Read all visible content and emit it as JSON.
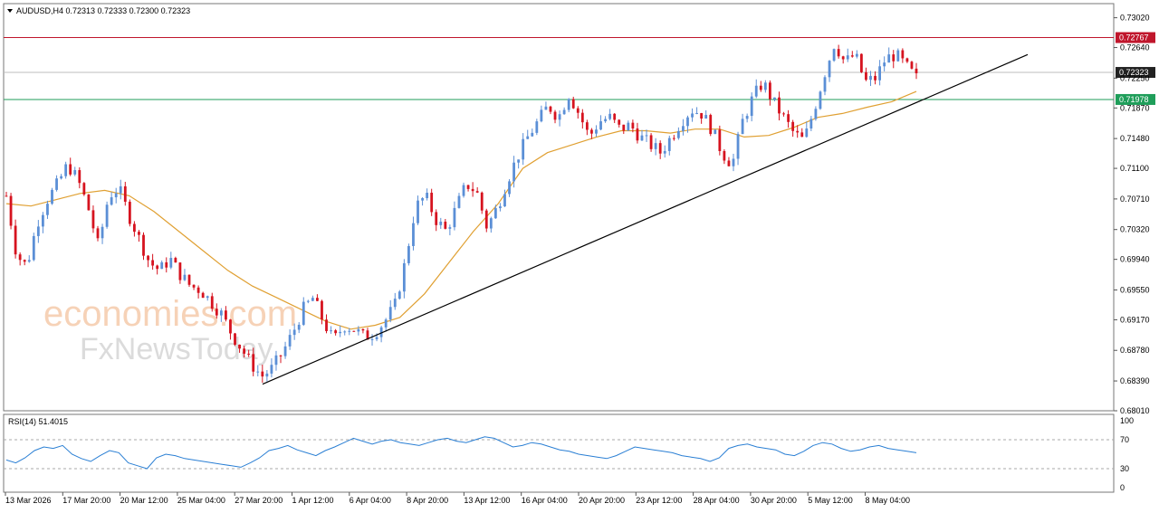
{
  "chart_data": {
    "type": "candlestick",
    "symbol_line": "AUDUSD,H4  0.72313 0.72333 0.72300 0.72323",
    "ylim": [
      0.6801,
      0.732
    ],
    "y_ticks": [
      "0.73020",
      "0.72640",
      "0.72250",
      "0.71870",
      "0.71480",
      "0.71100",
      "0.70710",
      "0.70320",
      "0.69940",
      "0.69550",
      "0.69170",
      "0.68780",
      "0.68390",
      "0.68010"
    ],
    "x_ticks": [
      "13 Mar 2026",
      "17 Mar 20:00",
      "20 Mar 12:00",
      "25 Mar 04:00",
      "27 Mar 20:00",
      "1 Apr 12:00",
      "6 Apr 04:00",
      "8 Apr 20:00",
      "13 Apr 12:00",
      "16 Apr 04:00",
      "20 Apr 20:00",
      "23 Apr 12:00",
      "28 Apr 04:00",
      "30 Apr 20:00",
      "5 May 12:00",
      "8 May 04:00"
    ],
    "horizontal_levels": [
      {
        "label": "0.72767",
        "value": 0.72767,
        "color": "#c0162c"
      },
      {
        "label": "0.72323",
        "value": 0.72323,
        "color": "#222222"
      },
      {
        "label": "0.71978",
        "value": 0.71978,
        "color": "#1f9e5a"
      }
    ],
    "trendline": {
      "from": [
        0,
        0.6835
      ],
      "to": [
        1,
        0.7255
      ]
    },
    "close_path": [
      0.7075,
      0.7,
      0.6985,
      0.704,
      0.707,
      0.709,
      0.7115,
      0.7095,
      0.706,
      0.701,
      0.7075,
      0.7085,
      0.705,
      0.702,
      0.699,
      0.698,
      0.6995,
      0.6975,
      0.696,
      0.6955,
      0.694,
      0.6925,
      0.69,
      0.688,
      0.686,
      0.6845,
      0.6855,
      0.6875,
      0.69,
      0.693,
      0.6945,
      0.6915,
      0.689,
      0.691,
      0.6905,
      0.6895,
      0.69,
      0.6915,
      0.6935,
      0.699,
      0.706,
      0.7075,
      0.7045,
      0.703,
      0.706,
      0.709,
      0.708,
      0.7035,
      0.706,
      0.7095,
      0.7125,
      0.715,
      0.717,
      0.719,
      0.7175,
      0.7205,
      0.718,
      0.715,
      0.717,
      0.7175,
      0.716,
      0.7165,
      0.715,
      0.714,
      0.713,
      0.715,
      0.717,
      0.7185,
      0.718,
      0.716,
      0.713,
      0.7115,
      0.717,
      0.72,
      0.722,
      0.7195,
      0.7175,
      0.7155,
      0.7145,
      0.7185,
      0.723,
      0.727,
      0.7245,
      0.7255,
      0.722,
      0.7225,
      0.725,
      0.7255,
      0.724,
      0.7225
    ],
    "ma_path": [
      0.7065,
      0.7062,
      0.707,
      0.7078,
      0.7082,
      0.7075,
      0.7055,
      0.703,
      0.7005,
      0.698,
      0.696,
      0.6945,
      0.693,
      0.6915,
      0.6905,
      0.691,
      0.692,
      0.695,
      0.699,
      0.703,
      0.7065,
      0.711,
      0.713,
      0.714,
      0.715,
      0.7158,
      0.7158,
      0.7155,
      0.716,
      0.716,
      0.715,
      0.7152,
      0.7162,
      0.7175,
      0.718,
      0.7188,
      0.7195,
      0.7208
    ],
    "rsi": {
      "label": "RSI(14) 51.4015",
      "scale": [
        "100",
        "70",
        "30",
        "0"
      ],
      "levels": [
        70,
        30
      ],
      "color": "#2a7fd4",
      "values": [
        42,
        38,
        45,
        55,
        60,
        58,
        62,
        50,
        44,
        40,
        48,
        55,
        52,
        38,
        34,
        30,
        45,
        50,
        48,
        44,
        42,
        40,
        38,
        36,
        34,
        32,
        38,
        45,
        55,
        58,
        62,
        56,
        52,
        48,
        55,
        60,
        66,
        72,
        68,
        64,
        68,
        70,
        66,
        64,
        62,
        66,
        70,
        72,
        68,
        66,
        70,
        74,
        72,
        66,
        60,
        62,
        66,
        64,
        60,
        56,
        54,
        50,
        48,
        46,
        44,
        48,
        54,
        60,
        58,
        56,
        54,
        52,
        48,
        46,
        44,
        40,
        45,
        58,
        62,
        64,
        60,
        58,
        56,
        50,
        48,
        54,
        62,
        66,
        64,
        58,
        54,
        56,
        60,
        62,
        58,
        56,
        54,
        52
      ]
    },
    "colors": {
      "bull": "#5b8fd6",
      "bear": "#d6131f",
      "ma": "#e0a032",
      "trend": "#000000",
      "grid": "#c8c8c8"
    }
  },
  "watermark": {
    "line1": "economies.com",
    "line2": "FxNewsToday"
  }
}
